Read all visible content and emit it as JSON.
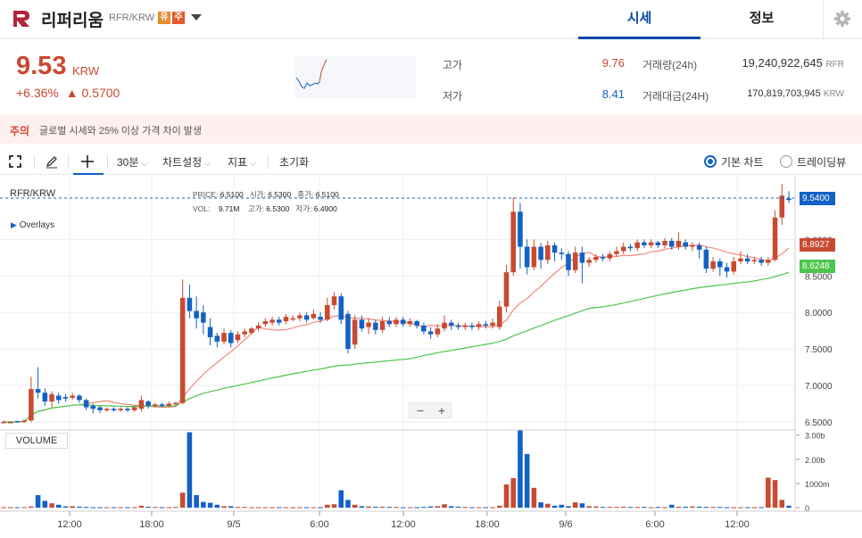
{
  "header": {
    "coin_name": "리퍼리움",
    "pair": "RFR/KRW",
    "badge1": "유",
    "badge2": "주",
    "tabs": [
      "시세",
      "정보"
    ]
  },
  "summary": {
    "price": "9.53",
    "unit": "KRW",
    "change_pct": "+6.36%",
    "change_abs": "▲ 0.5700",
    "high_label": "고가",
    "high_value": "9.76",
    "low_label": "저가",
    "low_value": "8.41",
    "volume_label": "거래량(24h)",
    "volume_value": "19,240,922,645",
    "volume_unit": "RFR",
    "amount_label": "거래대금(24H)",
    "amount_value": "170,819,703,945",
    "amount_unit": "KRW"
  },
  "warning": {
    "tag": "주의",
    "text": "글로벌 시세와 25% 이상 가격 차이 발생"
  },
  "toolbar": {
    "interval": "30분",
    "chart_settings": "차트설정",
    "indicators": "지표",
    "reset": "초기화",
    "basic_chart": "기본 차트",
    "trading_view": "트레이딩뷰"
  },
  "chart_info": {
    "pair": "RFR/KRW",
    "overlays": "Overlays",
    "price_label": "PRICE:",
    "price_value": "6.5100",
    "open_label": "시가:",
    "open_value": "6.5300",
    "close_label": "종가:",
    "close_value": "6.5100",
    "vol_label": "VOL:",
    "vol_value": "9.71M",
    "high_label": "고가:",
    "high_value": "6.5300",
    "low_label": "저가:",
    "low_value": "6.4900",
    "volume_panel": "VOLUME",
    "last_price_tag": "9.5400",
    "ma_short_tag": "8.8927",
    "ma_long_tag": "8.6248"
  },
  "chart_data": {
    "type": "candlestick",
    "y_ticks": [
      "9.0000",
      "8.5000",
      "8.0000",
      "7.5000",
      "7.0000",
      "6.5000"
    ],
    "vol_ticks": [
      "3.00b",
      "2.00b",
      "1000m",
      "0"
    ],
    "x_ticks": [
      "12:00",
      "18:00",
      "9/5",
      "6:00",
      "12:00",
      "18:00",
      "9/6",
      "6:00",
      "12:00"
    ],
    "ylim": [
      6.45,
      9.75
    ],
    "vol_lim": [
      0,
      3.1
    ],
    "colors": {
      "up": "#c84a31",
      "down": "#1261c4",
      "ma_short": "#f08a78",
      "ma_long": "#4cc64c",
      "last_tag": "#1261c4",
      "ma_short_tag": "#c84a31",
      "ma_long_tag": "#4cc64c"
    }
  }
}
